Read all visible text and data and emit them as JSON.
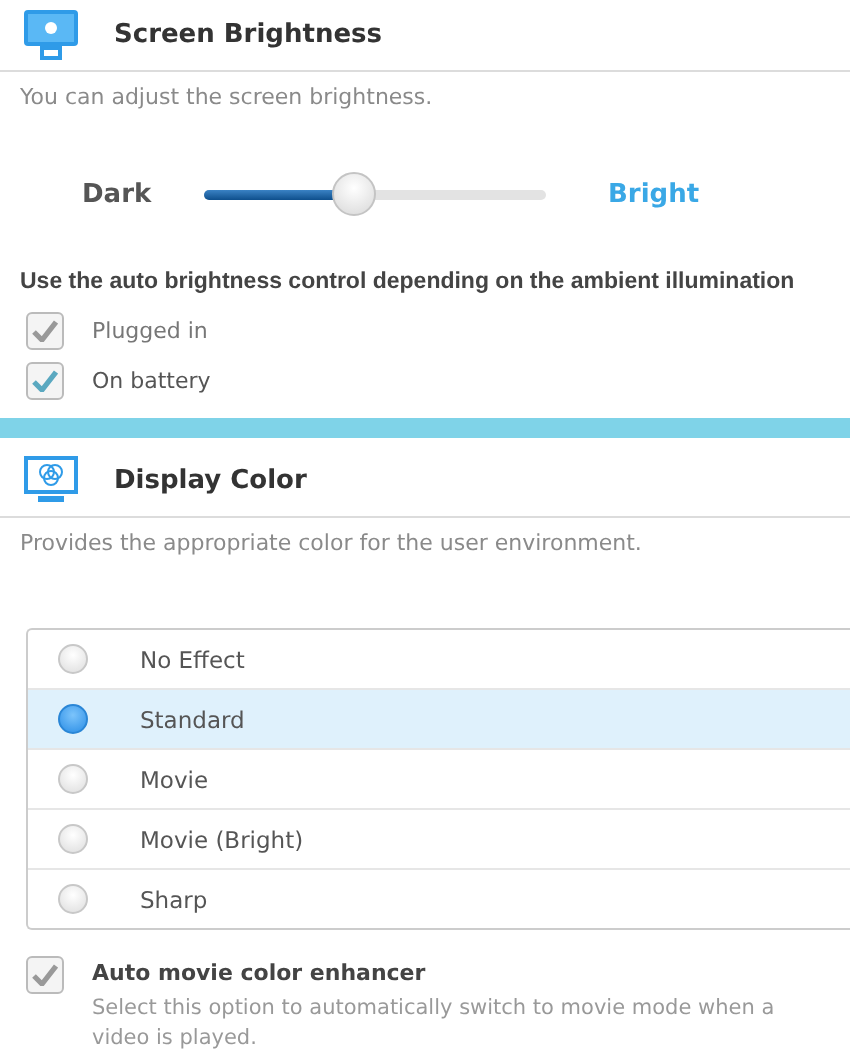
{
  "brightness": {
    "title": "Screen Brightness",
    "description": "You can adjust the screen brightness.",
    "min_label": "Dark",
    "max_label": "Bright",
    "level": 0.44,
    "auto_label": "Use the auto brightness control depending on the ambient illumination",
    "options": [
      {
        "label": "Plugged in",
        "checked": true,
        "disabled": true
      },
      {
        "label": "On battery",
        "checked": true,
        "disabled": false
      }
    ]
  },
  "display_color": {
    "title": "Display Color",
    "description": "Provides the appropriate color for the user environment.",
    "modes": [
      {
        "label": "No Effect",
        "selected": false
      },
      {
        "label": "Standard",
        "selected": true
      },
      {
        "label": "Movie",
        "selected": false
      },
      {
        "label": "Movie (Bright)",
        "selected": false
      },
      {
        "label": "Sharp",
        "selected": false
      }
    ],
    "enhancer": {
      "label": "Auto movie color enhancer",
      "description": "Select this option to automatically switch to movie mode when a video is played.",
      "checked": true,
      "disabled": true
    }
  }
}
